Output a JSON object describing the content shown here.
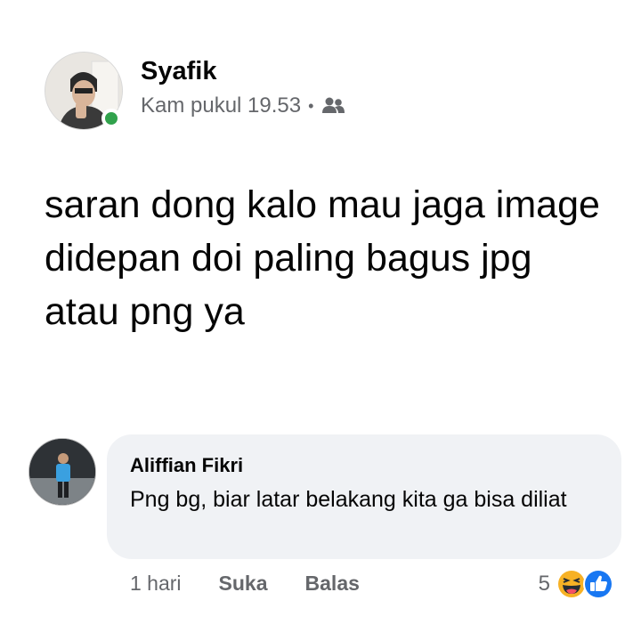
{
  "post": {
    "author": "Syafik",
    "time": "Kam pukul 19.53",
    "separator": "•",
    "audience_icon": "friends-icon",
    "body": "saran dong kalo mau jaga image didepan doi paling bagus jpg atau png ya"
  },
  "comment": {
    "author": "Aliffian Fikri",
    "text": "Png bg, biar latar belakang kita ga bisa diliat",
    "time": "1 hari",
    "like_label": "Suka",
    "reply_label": "Balas",
    "reaction_count": "5",
    "reaction_icons": [
      "haha-icon",
      "like-icon"
    ]
  },
  "colors": {
    "online": "#31a24c",
    "bubble": "#f0f2f5",
    "like_blue": "#1877f2",
    "haha_yellow": "#f7b125"
  }
}
